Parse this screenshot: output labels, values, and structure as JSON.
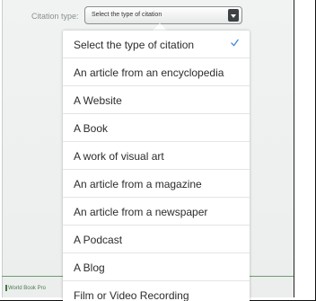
{
  "form": {
    "citation_label": "Citation type:",
    "selected_value": "Select the type of citation"
  },
  "dropdown": {
    "options": [
      "Select the type of citation",
      "An article from an encyclopedia",
      "A Website",
      "A Book",
      "A work of visual art",
      "An article from a magazine",
      "An article from a newspaper",
      "A Podcast",
      "A Blog",
      "Film or Video Recording"
    ],
    "selected_index": 0,
    "check_color": "#3a86d8",
    "check_icon": "checkmark-icon"
  },
  "footer": {
    "brand_text": "World Book Pro"
  },
  "colors": {
    "footer_line": "#6f9a6f",
    "footer_brand": "#4d7a4d"
  }
}
